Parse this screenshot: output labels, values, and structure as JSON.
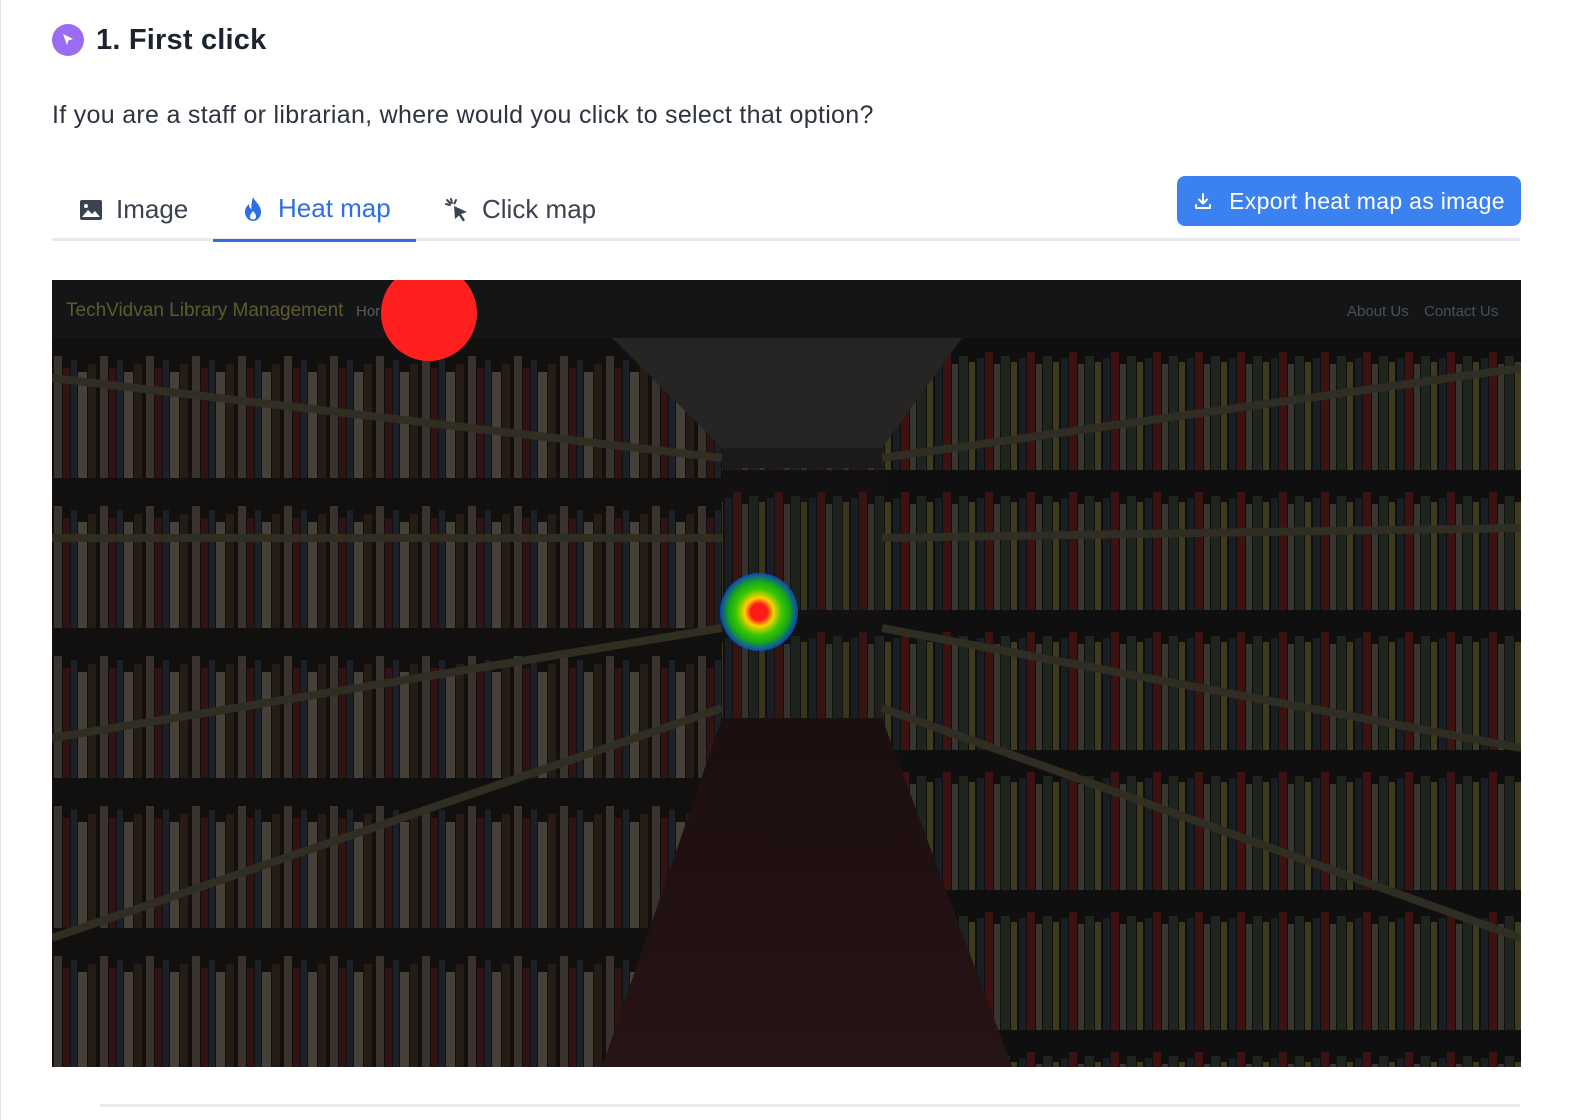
{
  "task": {
    "title": "1. First click",
    "question": "If you are a staff or librarian, where would you click to select that option?"
  },
  "tabs": [
    {
      "label": "Image",
      "icon": "image-icon",
      "active": false
    },
    {
      "label": "Heat map",
      "icon": "flame-icon",
      "active": true
    },
    {
      "label": "Click map",
      "icon": "cursor-click-icon",
      "active": false
    }
  ],
  "export_button": {
    "label": "Export heat map as image",
    "icon": "download-icon"
  },
  "preview": {
    "brand": "TechVidvan Library Management",
    "nav_home": "Hor",
    "nav_about": "About Us",
    "nav_contact": "Contact Us"
  },
  "colors": {
    "accent": "#2f6fe6",
    "button": "#3b82f0",
    "title_icon": "#9b6cf0",
    "heat_hot": "#ff1f1f",
    "heat_warm": "#ffdc00",
    "heat_mid": "#4ed400",
    "heat_cool": "#0050ff"
  }
}
